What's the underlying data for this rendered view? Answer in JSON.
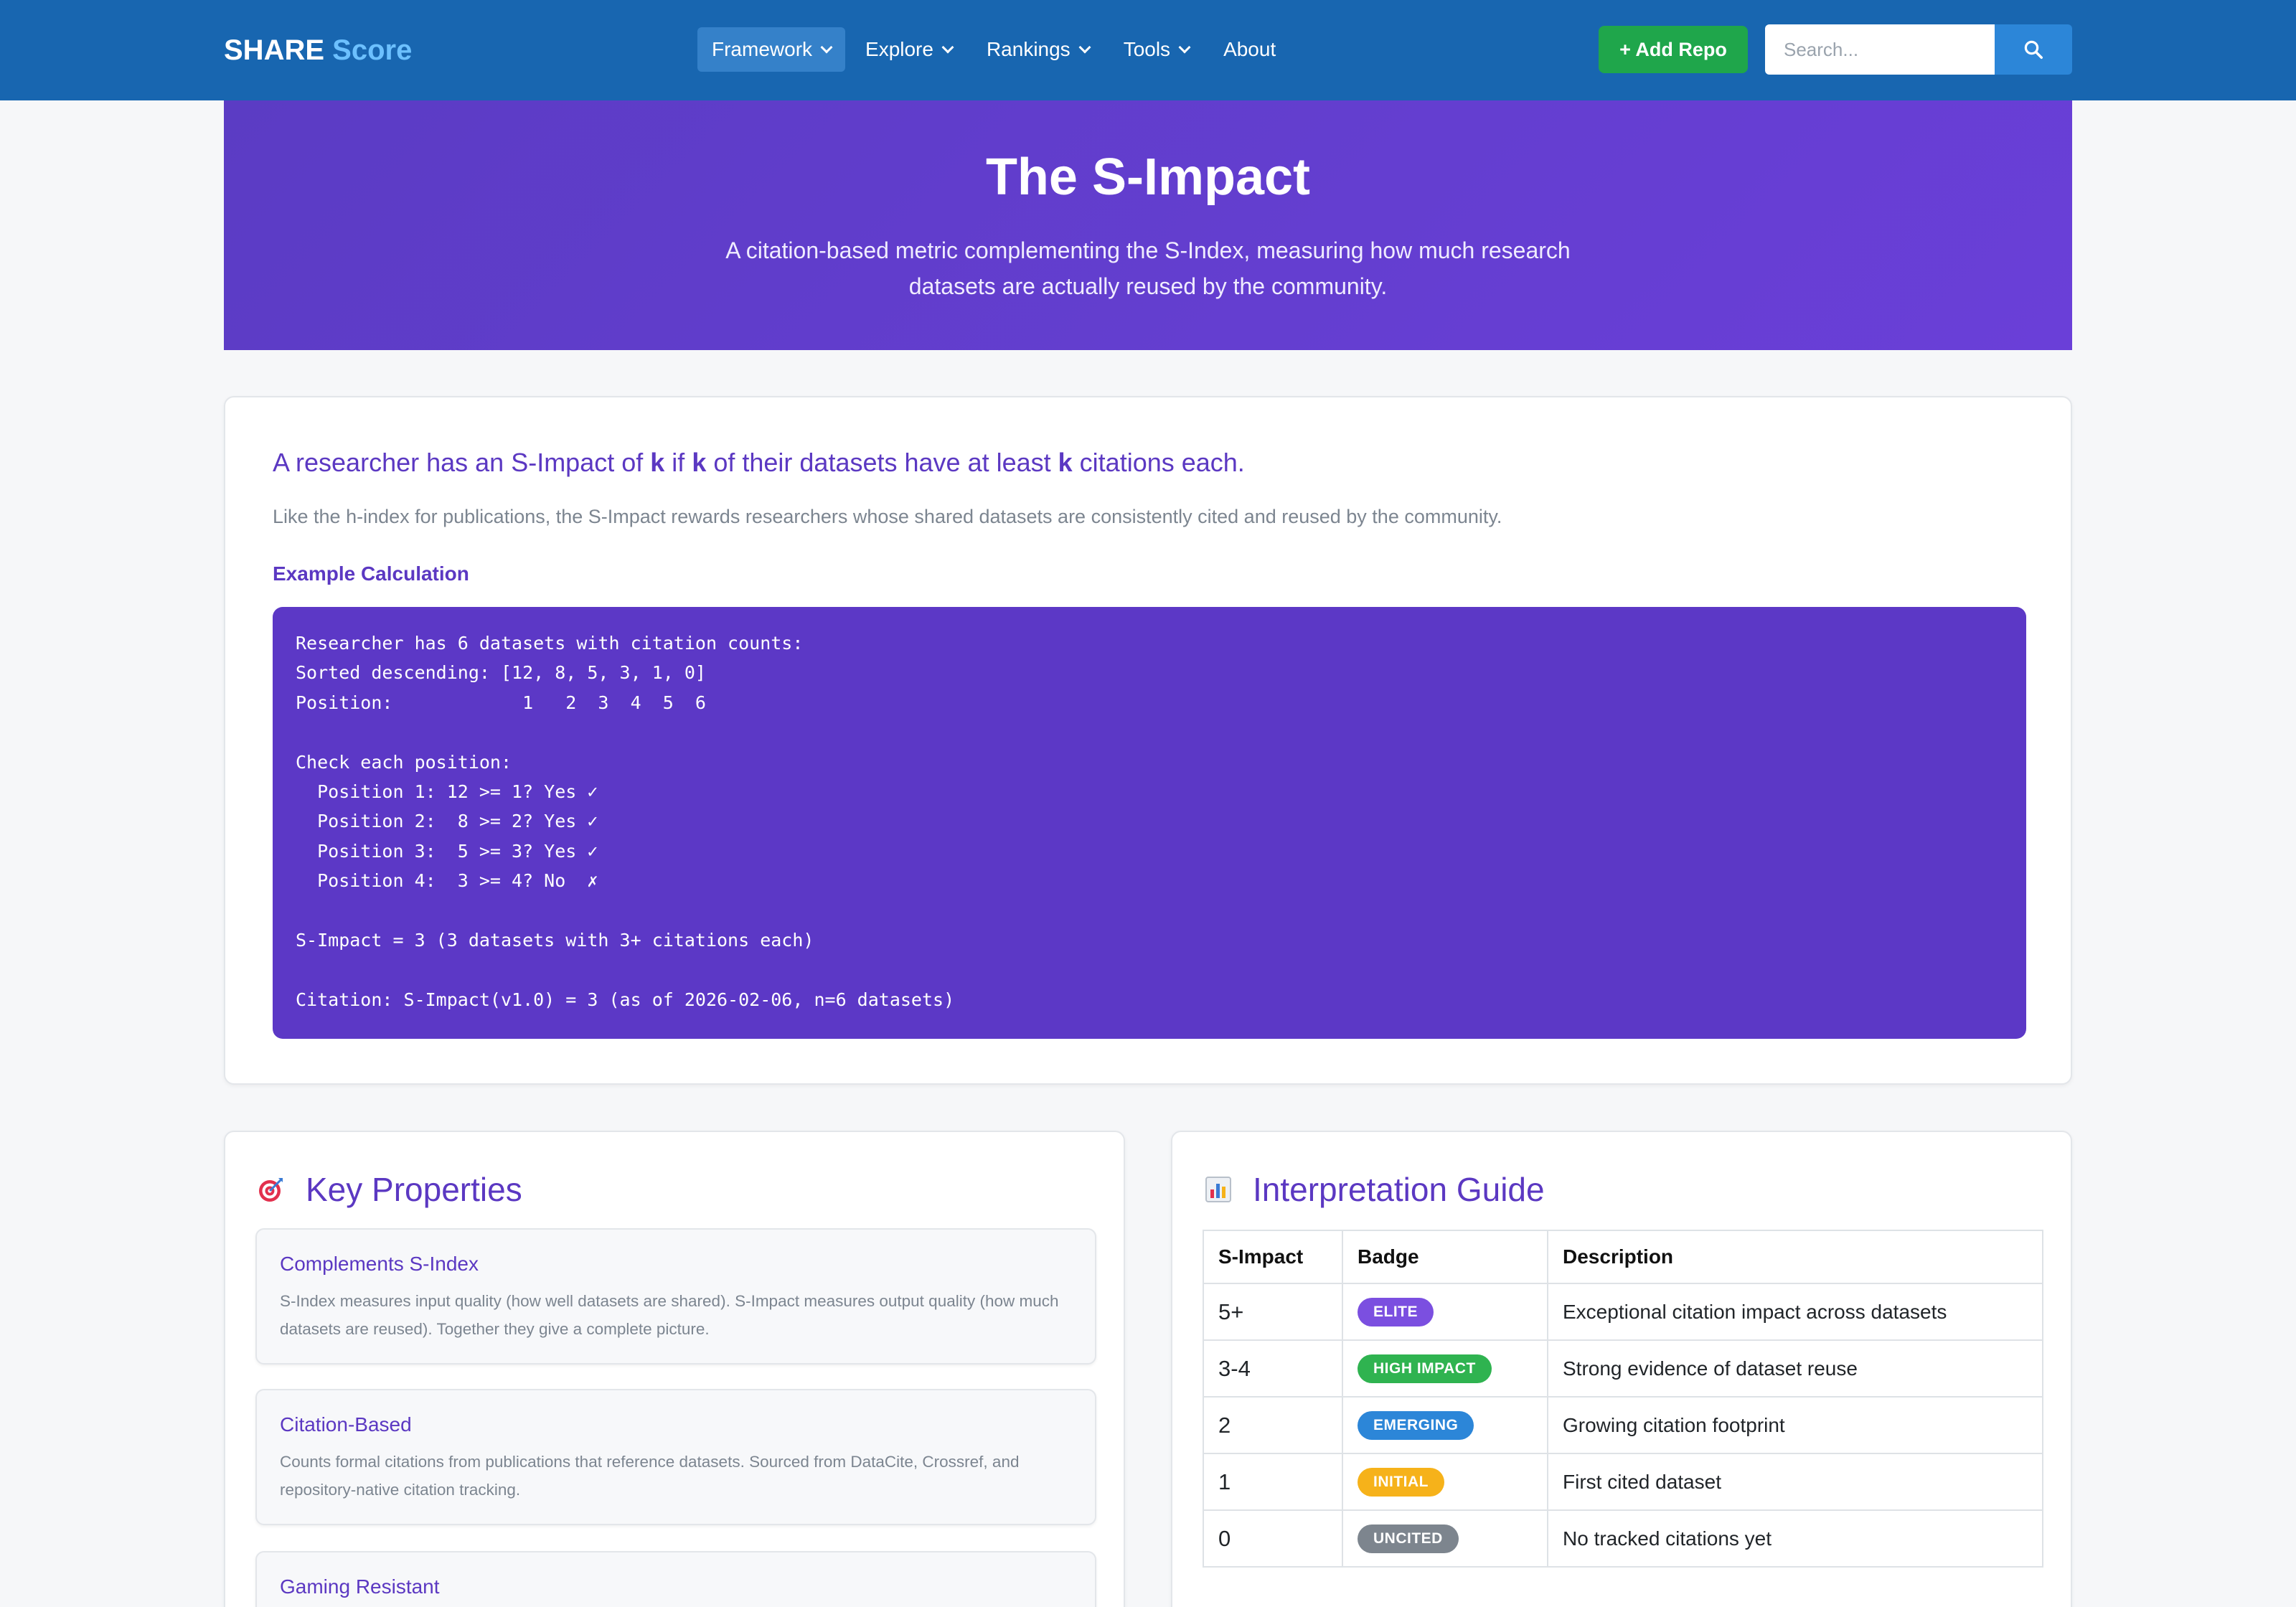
{
  "navbar": {
    "brand_main": "SHARE",
    "brand_accent": "Score",
    "menu": [
      {
        "label": "Framework",
        "dropdown": true,
        "active": true
      },
      {
        "label": "Explore",
        "dropdown": true
      },
      {
        "label": "Rankings",
        "dropdown": true
      },
      {
        "label": "Tools",
        "dropdown": true
      },
      {
        "label": "About",
        "dropdown": false
      }
    ],
    "add_repo_label": "+ Add Repo",
    "search_placeholder": "Search..."
  },
  "hero": {
    "title": "The S-Impact",
    "subtitle": "A citation-based metric complementing the S-Index, measuring how much research datasets are actually reused by the community."
  },
  "definition": {
    "statement_parts": [
      "A researcher has an S-Impact of ",
      "k",
      " if ",
      "k",
      " of their datasets have at least ",
      "k",
      " citations each."
    ],
    "description": "Like the h-index for publications, the S-Impact rewards researchers whose shared datasets are consistently cited and reused by the community.",
    "example_heading": "Example Calculation",
    "code_lines": [
      "Researcher has 6 datasets with citation counts:",
      "Sorted descending: [12, 8, 5, 3, 1, 0]",
      "Position:            1   2  3  4  5  6",
      "",
      "Check each position:",
      "  Position 1: 12 >= 1? Yes ✓",
      "  Position 2:  8 >= 2? Yes ✓",
      "  Position 3:  5 >= 3? Yes ✓",
      "  Position 4:  3 >= 4? No  ✗",
      "",
      "S-Impact = 3 (3 datasets with 3+ citations each)",
      "",
      "Citation: S-Impact(v1.0) = 3 (as of 2026-02-06, n=6 datasets)"
    ]
  },
  "key_properties": {
    "title": "Key Properties",
    "icon": "target-icon",
    "items": [
      {
        "title": "Complements S-Index",
        "description": "S-Index measures input quality (how well datasets are shared). S-Impact measures output quality (how much datasets are reused). Together they give a complete picture."
      },
      {
        "title": "Citation-Based",
        "description": "Counts formal citations from publications that reference datasets. Sourced from DataCite, Crossref, and repository-native citation tracking."
      },
      {
        "title": "Gaming Resistant",
        "description": ""
      }
    ]
  },
  "interpretation_guide": {
    "title": "Interpretation Guide",
    "icon": "bar-chart-icon",
    "headers": [
      "S-Impact",
      "Badge",
      "Description"
    ],
    "rows": [
      {
        "score": "5+",
        "badge": "ELITE",
        "badge_color": "#7b4fe0",
        "description": "Exceptional citation impact across datasets"
      },
      {
        "score": "3-4",
        "badge": "HIGH IMPACT",
        "badge_color": "#2fb350",
        "description": "Strong evidence of dataset reuse"
      },
      {
        "score": "2",
        "badge": "EMERGING",
        "badge_color": "#2c86d8",
        "description": "Growing citation footprint"
      },
      {
        "score": "1",
        "badge": "INITIAL",
        "badge_color": "#f6b21a",
        "description": "First cited dataset"
      },
      {
        "score": "0",
        "badge": "UNCITED",
        "badge_color": "#7d858e",
        "description": "No tracked citations yet"
      }
    ]
  },
  "colors": {
    "navbar": "#1866b0",
    "hero": "#6a3fd8",
    "accent": "#5b38c2",
    "code_bg": "#5c38c6",
    "add_button": "#1fa64b"
  }
}
